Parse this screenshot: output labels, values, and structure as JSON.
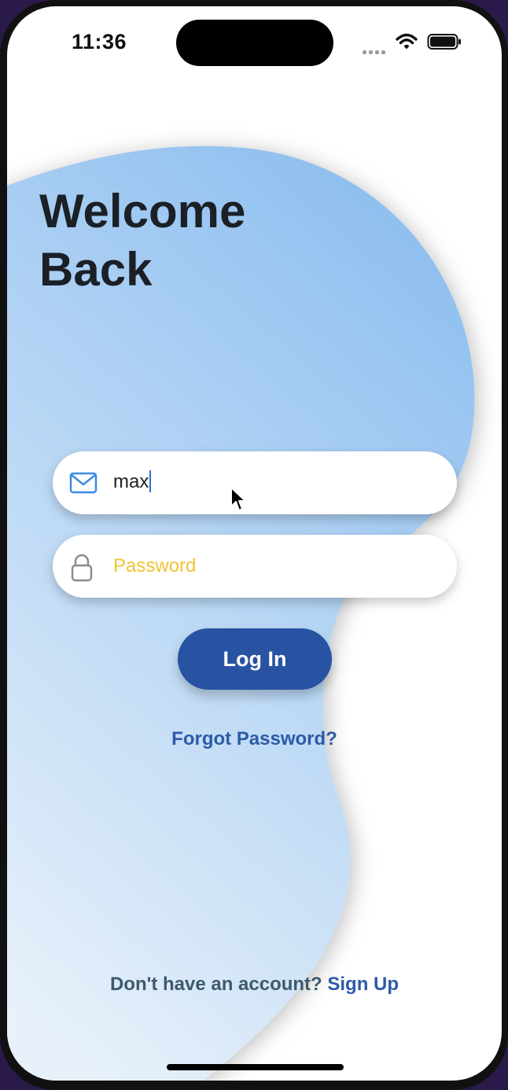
{
  "status_bar": {
    "time": "11:36"
  },
  "welcome": {
    "line1": "Welcome",
    "line2": "Back"
  },
  "login_form": {
    "email_value": "max",
    "password_placeholder": "Password",
    "login_label": "Log In",
    "forgot_label": "Forgot Password?"
  },
  "footer": {
    "signup_prompt": "Don't have an account?",
    "signup_label": "Sign Up"
  },
  "icons": {
    "email": "mail-icon",
    "password": "lock-icon",
    "wifi": "wifi-icon",
    "battery": "battery-icon",
    "pointer": "mouse-pointer-icon"
  },
  "colors": {
    "primary": "#2853a3",
    "link": "#2c5aa6",
    "placeholder": "#f1c232",
    "blob_top": "#93c2f0",
    "blob_bottom": "#e6f0fa",
    "title": "#1b2026"
  }
}
